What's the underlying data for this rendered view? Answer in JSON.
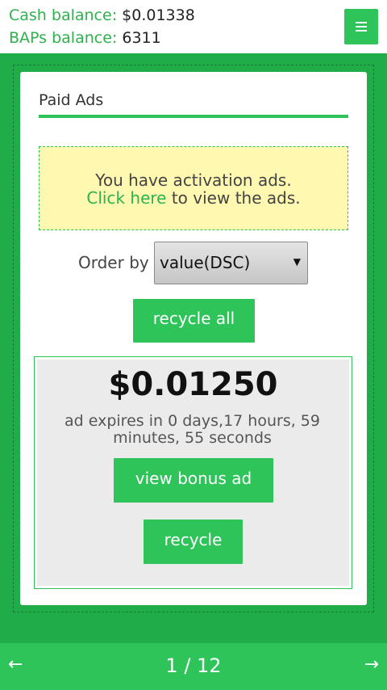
{
  "header": {
    "cash_label": "Cash balance:",
    "cash_value": "$0.01338",
    "baps_label": "BAPs balance:",
    "baps_value": "6311",
    "menu_icon": "hamburger-menu-icon"
  },
  "card": {
    "title": "Paid Ads",
    "notice": {
      "line1": "You have activation ads.",
      "link_text": "Click here",
      "line2_rest": "to view the ads."
    },
    "order": {
      "label": "Order by",
      "selected": "value(DSC)"
    },
    "recycle_all_label": "recycle all",
    "ad": {
      "value": "$0.01250",
      "expires": "ad expires in 0 days,17 hours, 59 minutes, 55 seconds",
      "view_bonus_label": "view bonus ad",
      "recycle_label": "recycle"
    }
  },
  "footer": {
    "prev_icon": "←",
    "pager": "1 / 12",
    "next_icon": "→"
  },
  "colors": {
    "accent": "#2ec45a",
    "background": "#20ad49",
    "notice_bg": "#fff8b0"
  }
}
